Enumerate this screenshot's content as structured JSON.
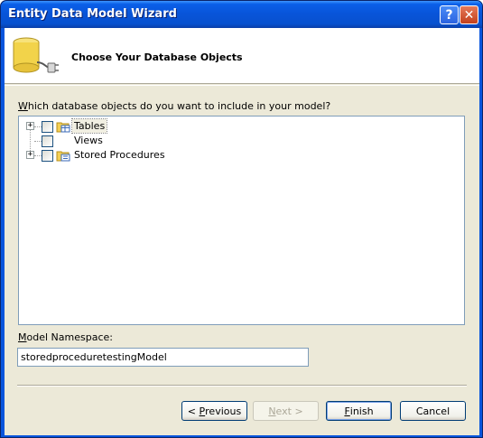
{
  "window": {
    "title": "Entity Data Model Wizard",
    "help_glyph": "?",
    "close_glyph": "✕"
  },
  "header": {
    "title": "Choose Your Database Objects",
    "icon": "database-plug-icon"
  },
  "question": {
    "prefix": "",
    "accel": "W",
    "rest": "hich database objects do you want to include in your model?"
  },
  "tree": {
    "items": [
      {
        "label": "Tables",
        "expandable": true,
        "expander": "+",
        "checked": false,
        "selected": true,
        "icon": "folder-table-icon"
      },
      {
        "label": "Views",
        "expandable": false,
        "expander": "",
        "checked": false,
        "selected": false,
        "icon": "folder-view-icon"
      },
      {
        "label": "Stored Procedures",
        "expandable": true,
        "expander": "+",
        "checked": false,
        "selected": false,
        "icon": "folder-proc-icon"
      }
    ]
  },
  "namespace": {
    "label_accel": "M",
    "label_rest": "odel Namespace:",
    "value": "storedproceduretestingModel"
  },
  "buttons": {
    "previous": {
      "prefix": "< ",
      "accel": "P",
      "rest": "revious",
      "enabled": true
    },
    "next": {
      "prefix": "",
      "accel": "N",
      "rest": "ext >",
      "enabled": false
    },
    "finish": {
      "prefix": "",
      "accel": "F",
      "rest": "inish",
      "enabled": true
    },
    "cancel": {
      "label": "Cancel",
      "enabled": true
    }
  }
}
